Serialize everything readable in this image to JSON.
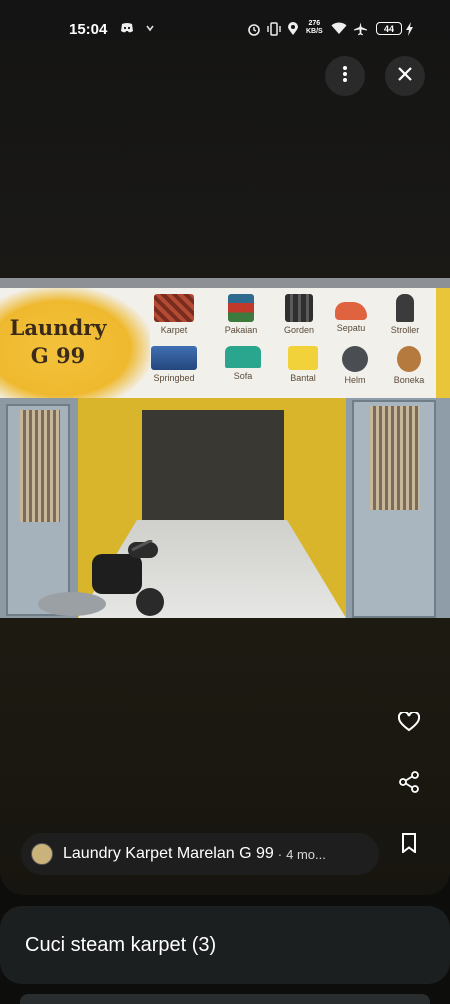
{
  "status_bar": {
    "time": "15:04",
    "network_speed_value": "276",
    "network_speed_unit": "KB/S",
    "battery": "44"
  },
  "top_actions": {
    "more_icon": "more-vertical-icon",
    "close_icon": "close-icon"
  },
  "photo": {
    "banner": {
      "brand_line1": "Laundry",
      "brand_line2": "G 99",
      "services": [
        "Karpet",
        "Pakaian",
        "Gorden",
        "Sepatu",
        "Stroller",
        "Springbed",
        "Sofa",
        "Bantal",
        "Helm",
        "Boneka"
      ]
    }
  },
  "side_actions": {
    "like_icon": "heart-outline-icon",
    "share_icon": "share-icon",
    "save_icon": "bookmark-icon"
  },
  "place": {
    "name": "Laundry Karpet Marelan G 99",
    "separator": "·",
    "time_ago": "4 mo..."
  },
  "album": {
    "title": "Cuci steam karpet (3)"
  },
  "colors": {
    "banner_yellow": "#efb92e",
    "interior_yellow": "#d9b52b",
    "card_bg": "#1c1f20"
  }
}
